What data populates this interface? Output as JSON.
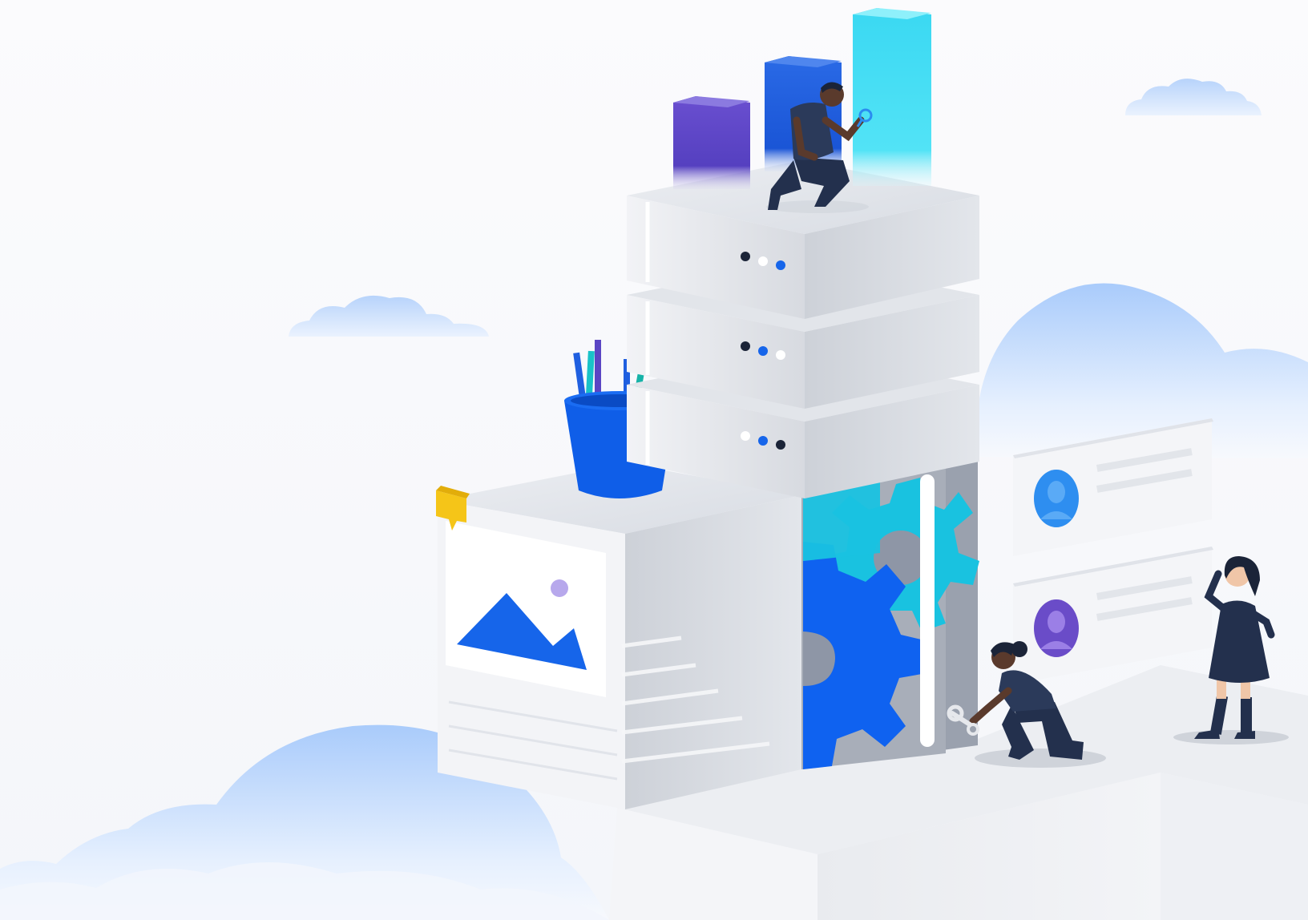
{
  "colors": {
    "background": "#f9fafc",
    "cloud_blue": "#c8ddfb",
    "server_light": "#e7e9ee",
    "server_mid": "#cfd3da",
    "server_dark": "#b9bec8",
    "bar_purple": "#5a45c4",
    "bar_blue": "#1f5fe0",
    "bar_cyan": "#35d5f0",
    "gear_blue": "#0f62f0",
    "gear_cyan": "#19c2e0",
    "gear_gray": "#8e96a6",
    "bucket_blue": "#0f5ee8",
    "mountain_blue": "#1665ea",
    "note_yellow": "#f5c518",
    "avatar_blue": "#2e8ef0",
    "avatar_purple": "#6a4cc8",
    "person_navy": "#23304d",
    "skin_dark": "#5a3a2c"
  },
  "icons": [
    "cloud-icon",
    "server-rack-icon",
    "bar-chart-icon",
    "gear-icon",
    "image-placeholder-icon",
    "pencil-cup-icon",
    "profile-card-icon",
    "sticky-note-icon",
    "wrench-icon",
    "magnifier-icon"
  ]
}
